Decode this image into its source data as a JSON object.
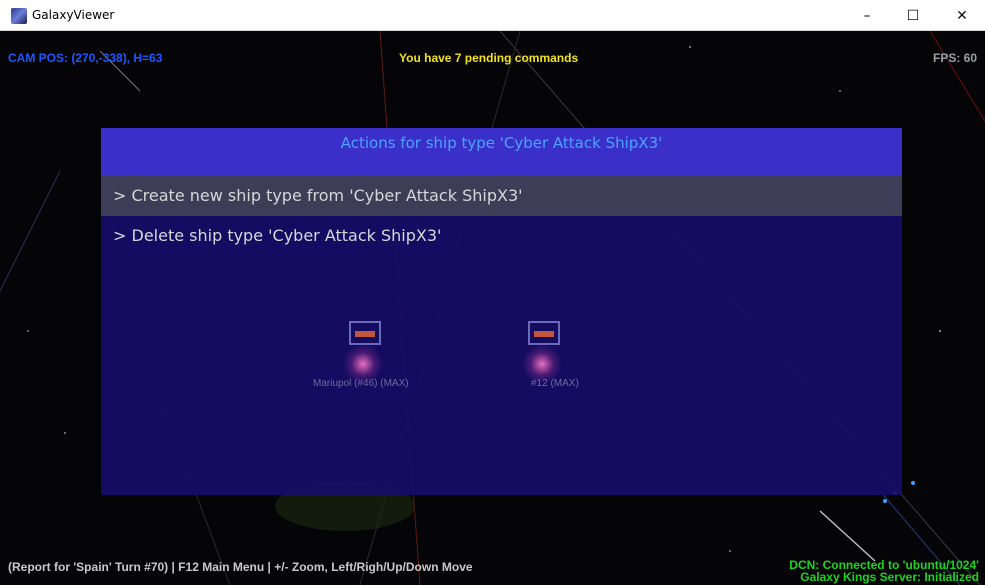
{
  "window": {
    "title": "GalaxyViewer",
    "minimize_glyph": "–",
    "maximize_glyph": "☐",
    "close_glyph": "✕"
  },
  "hud": {
    "cam_pos": "CAM POS: (270,-338), H=63",
    "pending": "You have 7 pending commands",
    "fps": "FPS: 60",
    "report": "(Report for 'Spain' Turn #70) | F12 Main Menu | +/- Zoom, Left/Righ/Up/Down Move",
    "dcn_line1": "DCN: Connected to 'ubuntu/1024'",
    "dcn_line2": "Galaxy Kings Server: Initialized"
  },
  "dialog": {
    "title": "Actions for ship type 'Cyber Attack ShipX3'",
    "items": [
      {
        "label": "> Create new ship type from 'Cyber Attack ShipX3'",
        "selected": true
      },
      {
        "label": "> Delete ship type 'Cyber Attack ShipX3'",
        "selected": false
      }
    ]
  },
  "background_labels": {
    "planet1": "Mariupol (#46) (MAX)",
    "planet2": "#12 (MAX)"
  },
  "colors": {
    "cam": "#1e57ff",
    "pending": "#f2e21a",
    "dcn": "#19d61c",
    "dialog_header": "#3b2fc9",
    "dialog_title": "#4aa3ff",
    "selected_item": "#3d3d58"
  },
  "icons": [
    "app-icon",
    "minimize-icon",
    "maximize-icon",
    "close-icon"
  ]
}
